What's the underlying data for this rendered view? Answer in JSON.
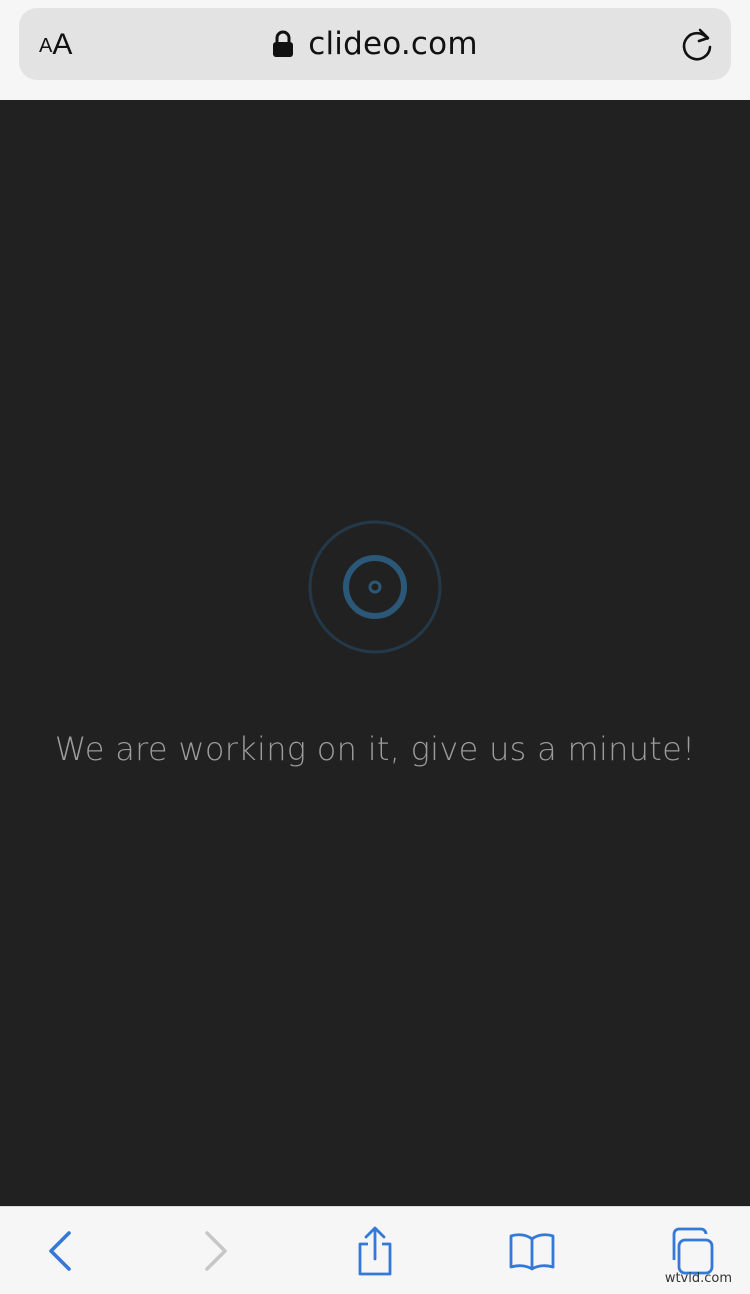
{
  "browser": {
    "text_size_small": "A",
    "text_size_large": "A",
    "url": "clideo.com",
    "lock_icon": "lock-icon",
    "reload_icon": "reload-icon"
  },
  "page": {
    "loader_icon": "loading-spinner-icon",
    "loader_color": "#2b5877",
    "message": "We are working on it, give us a minute!"
  },
  "toolbar": {
    "accent_color": "#3478d8",
    "disabled_color": "#c7c7c7",
    "items": [
      {
        "icon": "back-arrow-icon",
        "enabled": true
      },
      {
        "icon": "forward-arrow-icon",
        "enabled": false
      },
      {
        "icon": "share-icon",
        "enabled": true
      },
      {
        "icon": "bookmarks-icon",
        "enabled": true
      },
      {
        "icon": "tabs-icon",
        "enabled": true
      }
    ]
  },
  "watermark": "wtvid.com"
}
